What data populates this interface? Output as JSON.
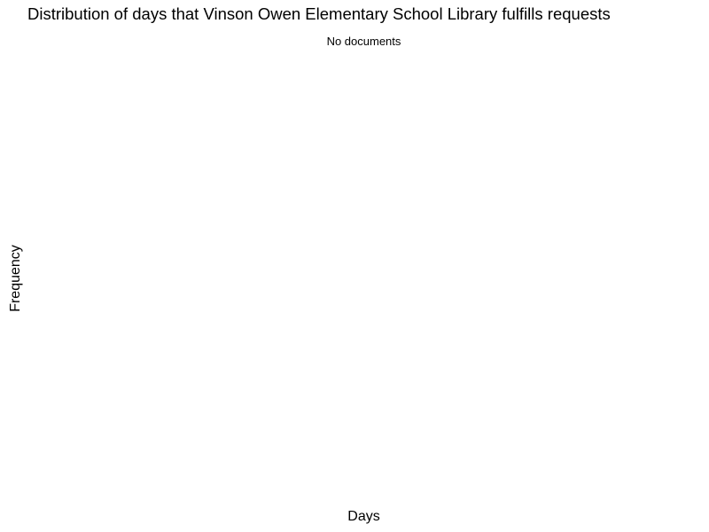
{
  "chart_data": {
    "type": "bar",
    "title": "Distribution of days that Vinson Owen Elementary School Library fulfills requests",
    "subtitle": "No documents",
    "xlabel": "Days",
    "ylabel": "Frequency",
    "categories": [],
    "values": [],
    "grid": false
  }
}
